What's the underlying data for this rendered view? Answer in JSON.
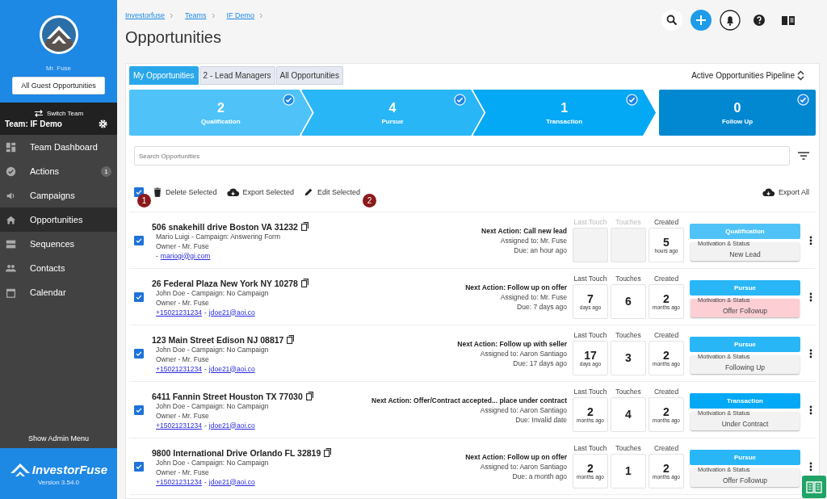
{
  "sidebar": {
    "user": "Mr. Fuse",
    "guest_button": "All Guest Opportunities",
    "switch_team": "Switch Team",
    "team": "Team: IF Demo",
    "items": [
      {
        "label": "Team Dashboard",
        "selected": false
      },
      {
        "label": "Actions",
        "badge": "1",
        "selected": false
      },
      {
        "label": "Campaigns",
        "selected": false
      },
      {
        "label": "Opportunities",
        "selected": true
      },
      {
        "label": "Sequences",
        "selected": false
      },
      {
        "label": "Contacts",
        "selected": false
      },
      {
        "label": "Calendar",
        "selected": false
      }
    ],
    "admin": "Show Admin Menu",
    "brand": "InvestorFuse",
    "version": "Version 3.54.0"
  },
  "breadcrumbs": [
    "Investorfuse",
    "Teams",
    "IF Demo"
  ],
  "title": "Opportunities",
  "tabs": [
    {
      "label": "My Opportunities",
      "selected": true
    },
    {
      "label": "2 - Lead Managers",
      "selected": false
    },
    {
      "label": "All Opportunities",
      "selected": false
    }
  ],
  "pipeline": "Active Opportunities Pipeline",
  "stages": [
    {
      "count": "2",
      "label": "Qualification",
      "color": "#4fc3f7",
      "checked": true
    },
    {
      "count": "4",
      "label": "Pursue",
      "color": "#29b6f6",
      "checked": true
    },
    {
      "count": "1",
      "label": "Transaction",
      "color": "#03a9f4",
      "checked": true
    },
    {
      "count": "0",
      "label": "Follow Up",
      "color": "#0288d1",
      "checked": true
    }
  ],
  "search": {
    "placeholder": "Search Opportunities"
  },
  "toolbar": {
    "select_all": true,
    "delete": "Delete Selected",
    "export": "Export Selected",
    "edit": "Edit Selected",
    "export_all": "Export All"
  },
  "markers": [
    "1",
    "2"
  ],
  "rows": [
    {
      "checked": true,
      "address": "506 snakehill drive Boston VA 31232",
      "contact": "Mario Luigi - Campaign: Answering Form",
      "owner": "Owner - Mr. Fuse",
      "separator": "-",
      "email": "mariogi@gi.com",
      "next_action": "Next Action: Call new lead",
      "assigned": "Assigned to: Mr. Fuse",
      "due": "Due: an hour ago",
      "metrics": [
        {
          "label": "Last Touch",
          "disabled": true
        },
        {
          "label": "Touches",
          "disabled": true
        },
        {
          "label": "Created",
          "disabled": false,
          "value": "5",
          "unit": "hours ago"
        }
      ],
      "stage": "Qualification",
      "color": "#4fc3f7",
      "status_label": "Motivation & Status",
      "status": "New Lead",
      "flagged": false
    },
    {
      "checked": true,
      "address": "26 Federal Plaza New York NY 10278",
      "contact": "John Doe - Campaign: No Campaign",
      "owner": "Owner - Mr. Fuse",
      "phone": "+15021231234",
      "separator": "-",
      "email": "jdoe21@aoi.co",
      "next_action": "Next Action: Follow up on offer",
      "assigned": "Assigned to: Mr. Fuse",
      "due": "Due: 7 days ago",
      "metrics": [
        {
          "label": "Last Touch",
          "disabled": false,
          "value": "7",
          "unit": "days ago"
        },
        {
          "label": "Touches",
          "disabled": false,
          "value": "6"
        },
        {
          "label": "Created",
          "disabled": false,
          "value": "2",
          "unit": "months ago"
        }
      ],
      "stage": "Pursue",
      "color": "#29b6f6",
      "status_label": "Motivation & Status",
      "status": "Offer Followup",
      "flagged": true
    },
    {
      "checked": true,
      "address": "123 Main Street Edison NJ 08817",
      "contact": "John Doe - Campaign: No Campaign",
      "owner": "Owner - Mr. Fuse",
      "phone": "+15021231234",
      "separator": "-",
      "email": "jdoe21@aoi.co",
      "next_action": "Next Action: Follow up with seller",
      "assigned": "Assigned to: Aaron Santiago",
      "due": "Due: 17 days ago",
      "metrics": [
        {
          "label": "Last Touch",
          "disabled": false,
          "value": "17",
          "unit": "days ago"
        },
        {
          "label": "Touches",
          "disabled": false,
          "value": "3"
        },
        {
          "label": "Created",
          "disabled": false,
          "value": "2",
          "unit": "months ago"
        }
      ],
      "stage": "Pursue",
      "color": "#29b6f6",
      "status_label": "Motivation & Status",
      "status": "Following Up",
      "flagged": false
    },
    {
      "checked": true,
      "address": "6411 Fannin Street Houston TX 77030",
      "contact": "John Doe - Campaign: No Campaign",
      "owner": "Owner - Mr. Fuse",
      "phone": "+15021231234",
      "separator": "-",
      "email": "jdoe21@aoi.co",
      "next_action": "Next Action: Offer/Contract accepted... place under contract",
      "assigned": "Assigned to: Aaron Santiago",
      "due": "Due: Invalid date",
      "metrics": [
        {
          "label": "Last Touch",
          "disabled": false,
          "value": "2",
          "unit": "months ago"
        },
        {
          "label": "Touches",
          "disabled": false,
          "value": "4"
        },
        {
          "label": "Created",
          "disabled": false,
          "value": "2",
          "unit": "months ago"
        }
      ],
      "stage": "Transaction",
      "color": "#03a9f4",
      "status_label": "Motivation & Status",
      "status": "Under Contract",
      "flagged": false
    },
    {
      "checked": true,
      "address": "9800 International Drive Orlando FL 32819",
      "contact": "John Doe - Campaign: No Campaign",
      "owner": "Owner - Mr. Fuse",
      "phone": "+15021231234",
      "separator": "-",
      "email": "jdoe21@aoi.co",
      "next_action": "Next Action: Follow up on offer",
      "assigned": "Assigned to: Aaron Santiago",
      "due": "Due: a month ago",
      "metrics": [
        {
          "label": "Last Touch",
          "disabled": false,
          "value": "2",
          "unit": "months ago"
        },
        {
          "label": "Touches",
          "disabled": false,
          "value": "1"
        },
        {
          "label": "Created",
          "disabled": false,
          "value": "2",
          "unit": "months ago"
        }
      ],
      "stage": "Pursue",
      "color": "#29b6f6",
      "status_label": "Motivation & Status",
      "status": "Offer Followup",
      "flagged": false
    }
  ]
}
